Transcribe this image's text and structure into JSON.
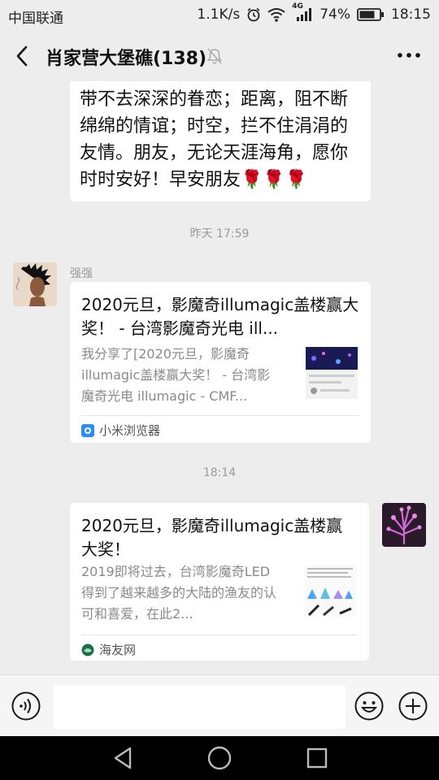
{
  "status_bar": {
    "carrier": "中国联通",
    "speed": "1.1K/s",
    "network": "4G",
    "battery": "74%",
    "time": "18:15"
  },
  "header": {
    "title": "肖家营大堡礁(138)"
  },
  "messages": {
    "first_text": [
      "带不去深深的眷恋；距离，阻不断",
      "绵绵的情谊；时空，拦不住涓涓的",
      "友情。朋友，无论天涯海角，愿你",
      "时时安好！早安朋友🌹🌹🌹"
    ],
    "time1": "昨天 17:59",
    "sender1": "强强",
    "card1": {
      "title": "2020元旦，影魔奇illumagic盖楼赢大奖！ - 台湾影魔奇光电 ill...",
      "desc": "我分享了[2020元旦，影魔奇illumagic盖楼赢大奖！ - 台湾影魔奇光电 illumagic - CMF...",
      "source": "小米浏览器",
      "source_icon": "browser-icon"
    },
    "time2": "18:14",
    "card2": {
      "title": "2020元旦，影魔奇illumagic盖楼赢大奖！",
      "desc": "2019即将过去，台湾影魔奇LED得到了越来越多的大陆的渔友的认可和喜爱，在此2...",
      "source": "海友网",
      "source_icon": "site-icon"
    }
  },
  "input": {
    "placeholder": "",
    "value": ""
  },
  "colors": {
    "background": "#ededed",
    "bubble": "#ffffff",
    "muted_text": "#9a9a9a"
  }
}
